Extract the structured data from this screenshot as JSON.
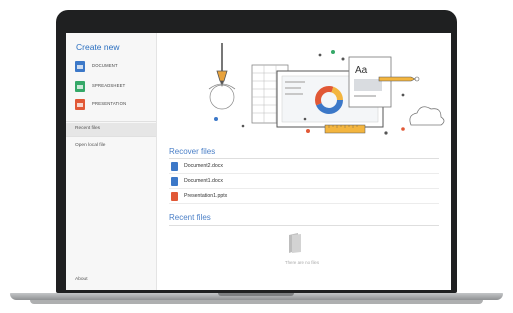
{
  "sidebar": {
    "create_title": "Create new",
    "create_items": [
      {
        "label": "DOCUMENT",
        "icon": "document-icon",
        "color": "#3c78c8"
      },
      {
        "label": "SPREADSHEET",
        "icon": "spreadsheet-icon",
        "color": "#35a868"
      },
      {
        "label": "PRESENTATION",
        "icon": "presentation-icon",
        "color": "#e15836"
      }
    ],
    "nav": [
      {
        "label": "Recent files",
        "active": true
      },
      {
        "label": "Open local file",
        "active": false
      }
    ],
    "about": "About"
  },
  "main": {
    "recover_title": "Recover files",
    "recover_files": [
      {
        "name": "Document2.docx",
        "icon": "docx-file-icon",
        "color": "#3c78c8"
      },
      {
        "name": "Document1.docx",
        "icon": "docx-file-icon",
        "color": "#3c78c8"
      },
      {
        "name": "Presentation1.pptx",
        "icon": "pptx-file-icon",
        "color": "#e15836"
      }
    ],
    "recent_title": "Recent files",
    "empty_text": "There are no files",
    "illustration_text": "Aa"
  }
}
